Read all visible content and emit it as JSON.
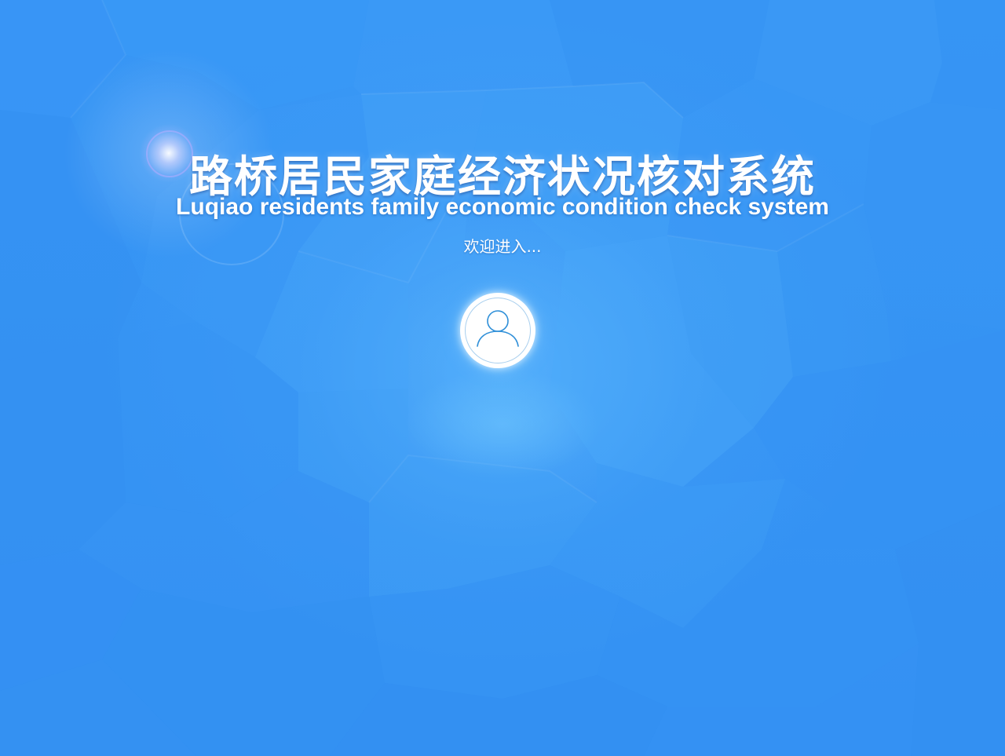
{
  "header": {
    "title_cn": "路桥居民家庭经济状况核对系统",
    "title_en": "Luqiao residents family economic condition check system",
    "welcome": "欢迎进入..."
  },
  "avatar": {
    "icon": "user-icon"
  },
  "colors": {
    "background": "#3390f2",
    "icon_stroke": "#2f8fd8",
    "text": "#ffffff"
  }
}
